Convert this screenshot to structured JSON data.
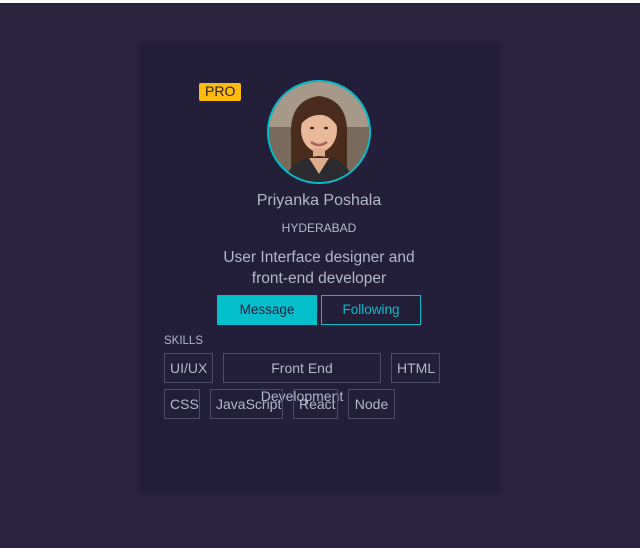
{
  "colors": {
    "page_background": "#28223f",
    "card_background": "#231e39",
    "accent": "#03bfcb",
    "badge": "#febb0b",
    "text": "#b3b8cd",
    "skill_border": "#4e4a6a"
  },
  "profile": {
    "badge": "PRO",
    "avatar_icon": "user-avatar-photo",
    "name": "Priyanka Poshala",
    "city": "HYDERABAD",
    "bio_line1": "User Interface designer and",
    "bio_line2": "front-end developer"
  },
  "actions": {
    "message_label": "Message",
    "following_label": "Following"
  },
  "skills": {
    "title": "SKILLS",
    "items": [
      "UI/UX",
      "Front End Development",
      "HTML",
      "CSS",
      "JavaScript",
      "React",
      "Node"
    ]
  }
}
